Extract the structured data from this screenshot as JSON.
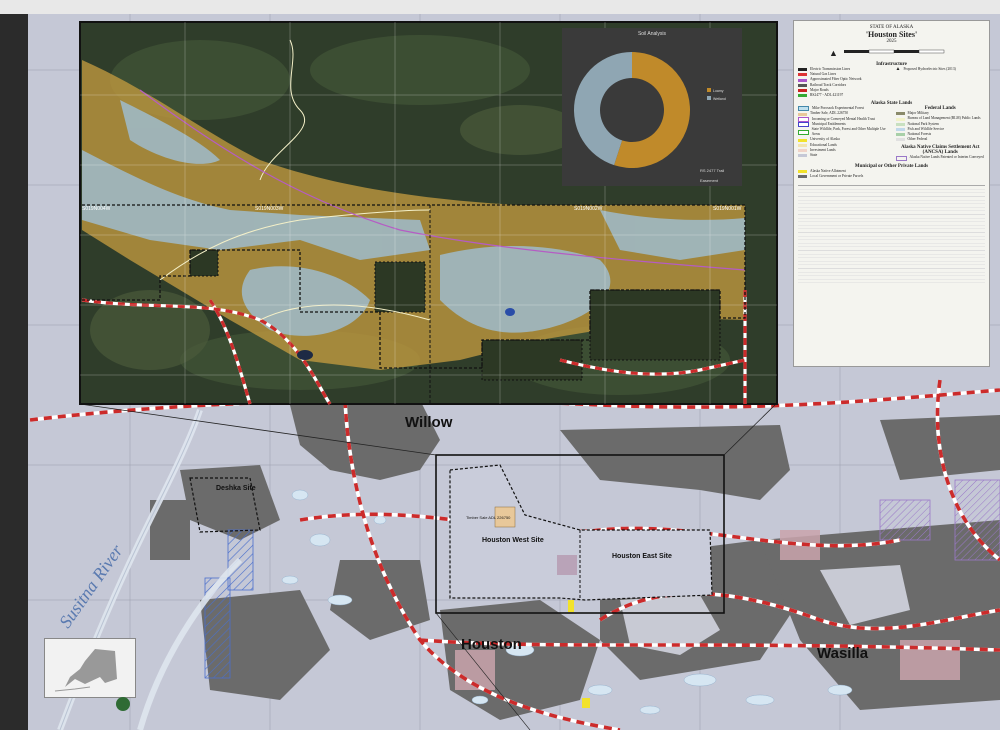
{
  "map": {
    "towns": [
      "Willow",
      "Houston",
      "Wasilla"
    ],
    "sites": [
      "Deshka Site",
      "Houston West Site",
      "Houston East Site",
      "Timber Sale ADL 226750"
    ],
    "river": "Susitna River",
    "grid_labels": [
      "S019N004W",
      "S019N003W",
      "S019N002W",
      "S019N001W"
    ],
    "colors": {
      "water_veg": "#a9c4d6",
      "soil_orange": "#c79a38",
      "road": "#cc2b2b",
      "land": "#c5c8d6",
      "private": "#6b6b6b"
    }
  },
  "legend": {
    "header": "STATE OF ALASKA",
    "title": "'Houston Sites'",
    "year": "2025",
    "infrastructure_heading": "Infrastructure",
    "infrastructure": [
      "Electric Transmission Lines",
      "Natural Gas Lines",
      "Approximated Fiber Optic Network",
      "Railroad Track Corridors",
      "Major Roads",
      "RS2477 - ADL 421197"
    ],
    "proposed": "Proposed Hydroelectric Sites (2013)",
    "state_heading": "Alaska State Lands",
    "state_items": [
      "Mike Poroszok Experimental Forest",
      "Timber Sale, ADL 226750",
      "Incoming or Conveyed Mental Health Trust",
      "Municipal Entitlements",
      "State Wildlife, Park, Forest and Other Multiple Use Areas",
      "University of Alaska",
      "Educational Lands",
      "Investment Lands",
      "State"
    ],
    "federal_heading": "Federal Lands",
    "federal_items": [
      "Major Military",
      "Bureau of Land Management (BLM) Public Lands",
      "National Park System",
      "Fish and Wildlife Service",
      "National Forests",
      "Other Federal"
    ],
    "ancsa_heading": "Alaska Native Claims Settlement Act (ANCSA) Lands",
    "ancsa_items": [
      "Alaska Native Lands Patented or Interim Conveyed"
    ],
    "municipal_heading": "Municipal or Other Private Lands",
    "municipal_items": [
      "Alaska Native Allotment",
      "Local Government or Private Parcels"
    ]
  },
  "chart_data": {
    "type": "pie",
    "title": "Soil Analysis",
    "categories": [
      "Loamy",
      "Wetland"
    ],
    "values": [
      55,
      45
    ],
    "colors": [
      "#c08a2a",
      "#8fa6b3"
    ]
  },
  "inset_legend": {
    "rs": "RS 2477 Trail",
    "easement": "Easement"
  }
}
